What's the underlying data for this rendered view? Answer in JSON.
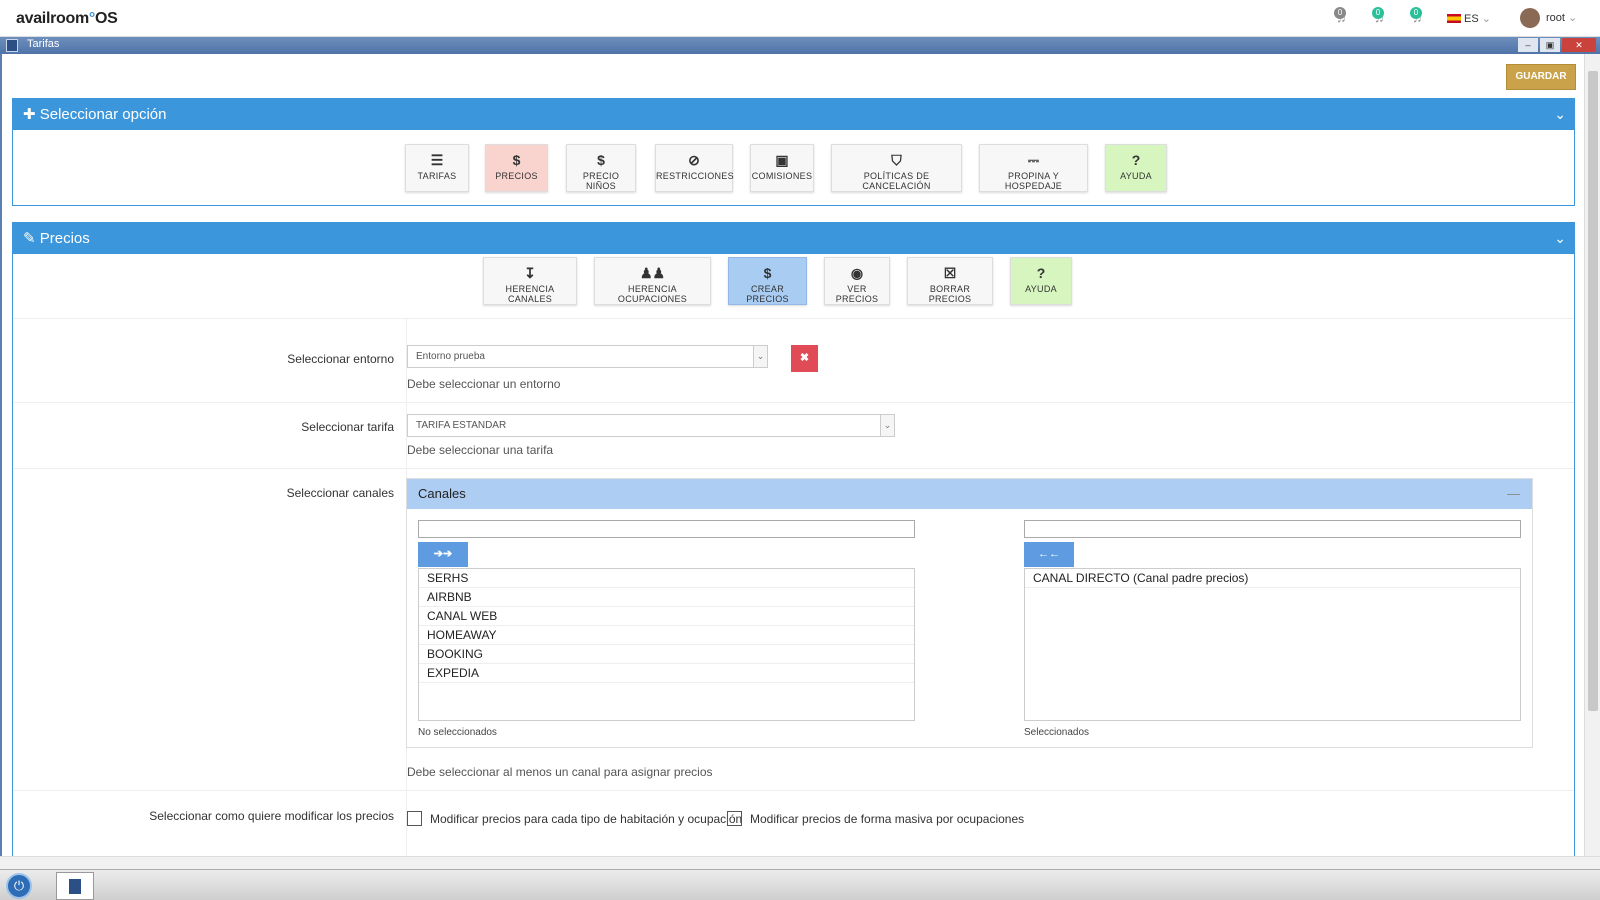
{
  "topbar": {
    "logo_left": "availroom",
    "logo_right": "OS",
    "notifications": [
      {
        "count": "0",
        "color": "#888888"
      },
      {
        "count": "0",
        "color": "#2bbf9a"
      },
      {
        "count": "0",
        "color": "#2bbf9a"
      }
    ],
    "language": "ES",
    "user": "root"
  },
  "window": {
    "title": "Tarifas",
    "minimize": "–",
    "restore": "▣",
    "close": "✕"
  },
  "toolbar": {
    "save_label": "GUARDAR"
  },
  "options_panel": {
    "title": "Seleccionar opción",
    "chevron": "⌄",
    "items": [
      {
        "icon": "list-icon",
        "glyph": "☰",
        "label": "TARIFAS"
      },
      {
        "icon": "dollar-icon",
        "glyph": "$",
        "label": "PRECIOS"
      },
      {
        "icon": "dollar-icon",
        "glyph": "$",
        "label": "PRECIO NIÑOS"
      },
      {
        "icon": "ban-icon",
        "glyph": "⊘",
        "label": "RESTRICCIONES"
      },
      {
        "icon": "money-icon",
        "glyph": "▣",
        "label": "COMISIONES"
      },
      {
        "icon": "shield-icon",
        "glyph": "⛉",
        "label": "POLÍTICAS DE CANCELACIÓN"
      },
      {
        "icon": "bed-icon",
        "glyph": "⎓",
        "label": "PROPINA Y HOSPEDAJE"
      },
      {
        "icon": "help-icon",
        "glyph": "?",
        "label": "AYUDA"
      }
    ]
  },
  "prices_panel": {
    "title": "Precios",
    "chevron": "⌄",
    "items": [
      {
        "icon": "sort-icon",
        "glyph": "↧",
        "label": "HERENCIA CANALES"
      },
      {
        "icon": "users-icon",
        "glyph": "♟♟",
        "label": "HERENCIA OCUPACIONES"
      },
      {
        "icon": "dollar-icon",
        "glyph": "$",
        "label": "CREAR PRECIOS"
      },
      {
        "icon": "eye-icon",
        "glyph": "◉",
        "label": "VER PRECIOS"
      },
      {
        "icon": "trash-icon",
        "glyph": "☒",
        "label": "BORRAR PRECIOS"
      },
      {
        "icon": "help-icon",
        "glyph": "?",
        "label": "AYUDA"
      }
    ]
  },
  "form": {
    "entorno_label": "Seleccionar entorno",
    "entorno_value": "Entorno prueba",
    "entorno_help": "Debe seleccionar un entorno",
    "clear_label": "✖",
    "tarifa_label": "Seleccionar tarifa",
    "tarifa_value": "TARIFA ESTANDAR",
    "tarifa_help": "Debe seleccionar una tarifa",
    "canales_label": "Seleccionar canales",
    "canales_help": "Debe seleccionar al menos un canal para asignar precios",
    "modo_label": "Seleccionar como quiere modificar los precios",
    "modo_option1": "Modificar precios para cada tipo de habitación y ocupación",
    "modo_option2": "Modificar precios de forma masiva por ocupaciones"
  },
  "canales": {
    "title": "Canales",
    "minimize": "—",
    "move_right": "➔➔",
    "move_left": "←←",
    "available": [
      "SERHS",
      "AIRBNB",
      "CANAL WEB",
      "HOMEAWAY",
      "BOOKING",
      "EXPEDIA"
    ],
    "selected": [
      "CANAL DIRECTO (Canal padre precios)"
    ],
    "available_caption": "No seleccionados",
    "selected_caption": "Seleccionados"
  },
  "colors": {
    "panel_header": "#3c96db",
    "save_button": "#c9a24a",
    "active_option": "#f9d4cf",
    "help_option": "#d6f5bf",
    "create_active": "#a9ccf2",
    "delete_button": "#e04b56"
  }
}
